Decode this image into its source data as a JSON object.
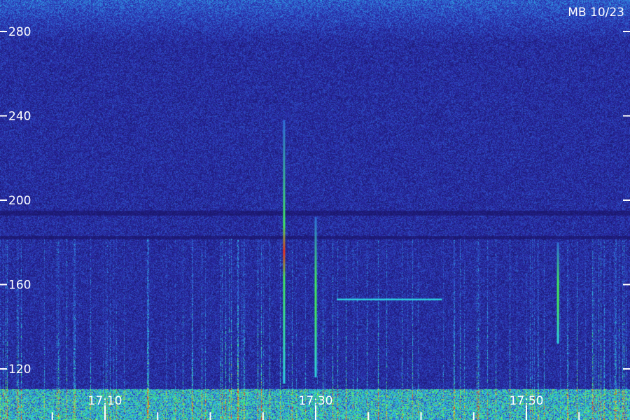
{
  "chart_data": {
    "type": "heatmap",
    "title": "",
    "station_label": "MB 10/23",
    "xlabel": "",
    "ylabel": "",
    "y_ticks": [
      280,
      240,
      200,
      160,
      120
    ],
    "x_tick_labels": [
      "17:10",
      "17:30",
      "17:50"
    ],
    "colormap": [
      "#1b1870",
      "#2a2aa8",
      "#2f6cd8",
      "#2fd0e0",
      "#40e860",
      "#e8e040",
      "#e83020"
    ],
    "background_color": "#1b1870",
    "features": [
      {
        "kind": "vertical-line",
        "time": "17:27",
        "y_range": [
          113,
          238
        ],
        "peak_color": "#e83020"
      },
      {
        "kind": "vertical-line",
        "time": "17:30",
        "y_range": [
          116,
          192
        ],
        "peak_color": "#40e860"
      },
      {
        "kind": "vertical-line",
        "time": "17:53",
        "y_range": [
          132,
          180
        ],
        "peak_color": "#40e860"
      },
      {
        "kind": "horizontal-line",
        "value": 153,
        "time_range": [
          "17:32",
          "17:42"
        ],
        "peak_color": "#2fd0e0"
      }
    ]
  }
}
